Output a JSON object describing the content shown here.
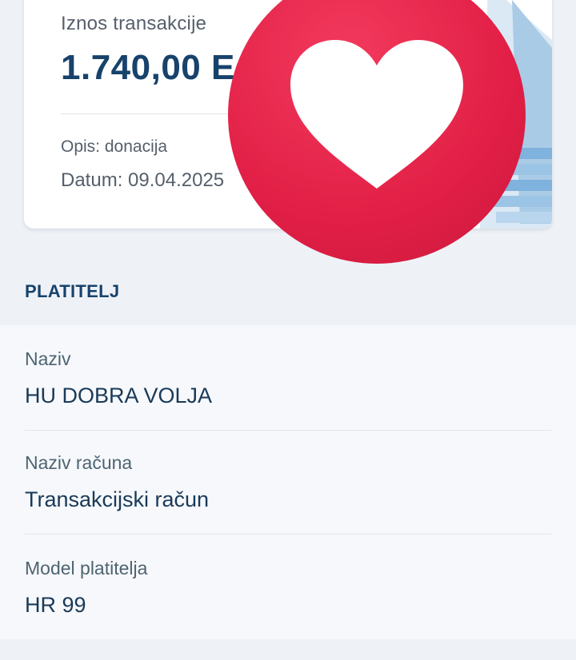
{
  "transaction": {
    "amount_label": "Iznos transakcije",
    "amount": "1.740,00 E",
    "description": "Opis: donacija",
    "date": "Datum: 09.04.2025"
  },
  "badge": {
    "icon": "heart-icon",
    "color": "#e21f46"
  },
  "payer": {
    "section_title": "PLATITELJ",
    "fields": [
      {
        "label": "Naziv",
        "value": "HU DOBRA VOLJA"
      },
      {
        "label": "Naziv računa",
        "value": "Transakcijski račun"
      },
      {
        "label": "Model platitelja",
        "value": "HR 99"
      }
    ]
  }
}
